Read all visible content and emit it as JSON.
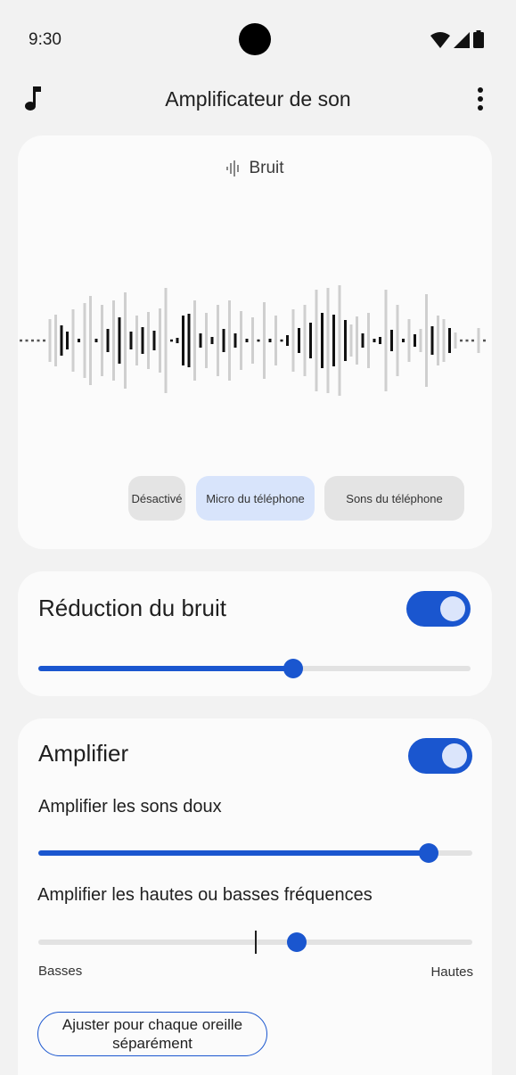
{
  "status": {
    "time": "9:30"
  },
  "app_bar": {
    "title": "Amplificateur de son"
  },
  "waveform_card": {
    "noise_label": "Bruit",
    "chips": [
      "Désactivé",
      "Micro du téléphone",
      "Sons du téléphone"
    ],
    "selected_chip": "Micro du téléphone",
    "bars": [
      {
        "h": 1,
        "dark": false
      },
      {
        "h": 1,
        "dark": false
      },
      {
        "h": 1,
        "dark": false
      },
      {
        "h": 1,
        "dark": false
      },
      {
        "h": 1,
        "dark": false
      },
      {
        "h": 48,
        "dark": false
      },
      {
        "h": 58,
        "dark": false
      },
      {
        "h": 34,
        "dark": true
      },
      {
        "h": 20,
        "dark": true
      },
      {
        "h": 70,
        "dark": false
      },
      {
        "h": 4,
        "dark": true
      },
      {
        "h": 84,
        "dark": false
      },
      {
        "h": 100,
        "dark": false
      },
      {
        "h": 4,
        "dark": true
      },
      {
        "h": 80,
        "dark": false
      },
      {
        "h": 26,
        "dark": true
      },
      {
        "h": 90,
        "dark": false
      },
      {
        "h": 52,
        "dark": true
      },
      {
        "h": 108,
        "dark": false
      },
      {
        "h": 20,
        "dark": true
      },
      {
        "h": 56,
        "dark": false
      },
      {
        "h": 30,
        "dark": true
      },
      {
        "h": 64,
        "dark": false
      },
      {
        "h": 22,
        "dark": true
      },
      {
        "h": 72,
        "dark": false
      },
      {
        "h": 118,
        "dark": false
      },
      {
        "h": 2,
        "dark": true
      },
      {
        "h": 6,
        "dark": true
      },
      {
        "h": 56,
        "dark": true
      },
      {
        "h": 60,
        "dark": true
      },
      {
        "h": 90,
        "dark": false
      },
      {
        "h": 16,
        "dark": true
      },
      {
        "h": 62,
        "dark": false
      },
      {
        "h": 8,
        "dark": true
      },
      {
        "h": 80,
        "dark": false
      },
      {
        "h": 26,
        "dark": true
      },
      {
        "h": 90,
        "dark": false
      },
      {
        "h": 16,
        "dark": true
      },
      {
        "h": 66,
        "dark": false
      },
      {
        "h": 4,
        "dark": true
      },
      {
        "h": 52,
        "dark": false
      },
      {
        "h": 2,
        "dark": true
      },
      {
        "h": 86,
        "dark": false
      },
      {
        "h": 4,
        "dark": true
      },
      {
        "h": 56,
        "dark": false
      },
      {
        "h": 2,
        "dark": true
      },
      {
        "h": 12,
        "dark": true
      },
      {
        "h": 70,
        "dark": false
      },
      {
        "h": 28,
        "dark": true
      },
      {
        "h": 80,
        "dark": false
      },
      {
        "h": 40,
        "dark": true
      },
      {
        "h": 114,
        "dark": false
      },
      {
        "h": 62,
        "dark": true
      },
      {
        "h": 118,
        "dark": false
      },
      {
        "h": 58,
        "dark": true
      },
      {
        "h": 124,
        "dark": false
      },
      {
        "h": 46,
        "dark": true
      },
      {
        "h": 36,
        "dark": false
      },
      {
        "h": 54,
        "dark": false
      },
      {
        "h": 16,
        "dark": true
      },
      {
        "h": 62,
        "dark": false
      },
      {
        "h": 4,
        "dark": true
      },
      {
        "h": 8,
        "dark": true
      },
      {
        "h": 114,
        "dark": false
      },
      {
        "h": 24,
        "dark": true
      },
      {
        "h": 80,
        "dark": false
      },
      {
        "h": 4,
        "dark": true
      },
      {
        "h": 48,
        "dark": false
      },
      {
        "h": 14,
        "dark": true
      },
      {
        "h": 26,
        "dark": false
      },
      {
        "h": 104,
        "dark": false
      },
      {
        "h": 32,
        "dark": true
      },
      {
        "h": 56,
        "dark": false
      },
      {
        "h": 48,
        "dark": false
      },
      {
        "h": 28,
        "dark": true
      },
      {
        "h": 18,
        "dark": false
      },
      {
        "h": 1,
        "dark": false
      },
      {
        "h": 1,
        "dark": false
      },
      {
        "h": 1,
        "dark": false
      },
      {
        "h": 28,
        "dark": false
      },
      {
        "h": 1,
        "dark": false
      }
    ]
  },
  "noise_card": {
    "title": "Réduction du bruit",
    "toggle_on": true,
    "slider_value": 0.59
  },
  "amp_card": {
    "title": "Amplifier",
    "toggle_on": true,
    "soft_label": "Amplifier les sons doux",
    "soft_value": 0.9,
    "freq_label": "Amplifier les hautes ou basses fréquences",
    "freq_value": 0.596,
    "freq_left": "Basses",
    "freq_right": "Hautes",
    "ear_button": "Ajuster pour chaque oreille séparément"
  },
  "colors": {
    "accent": "#1a56cf",
    "selected_chip": "#d8e4fb"
  }
}
